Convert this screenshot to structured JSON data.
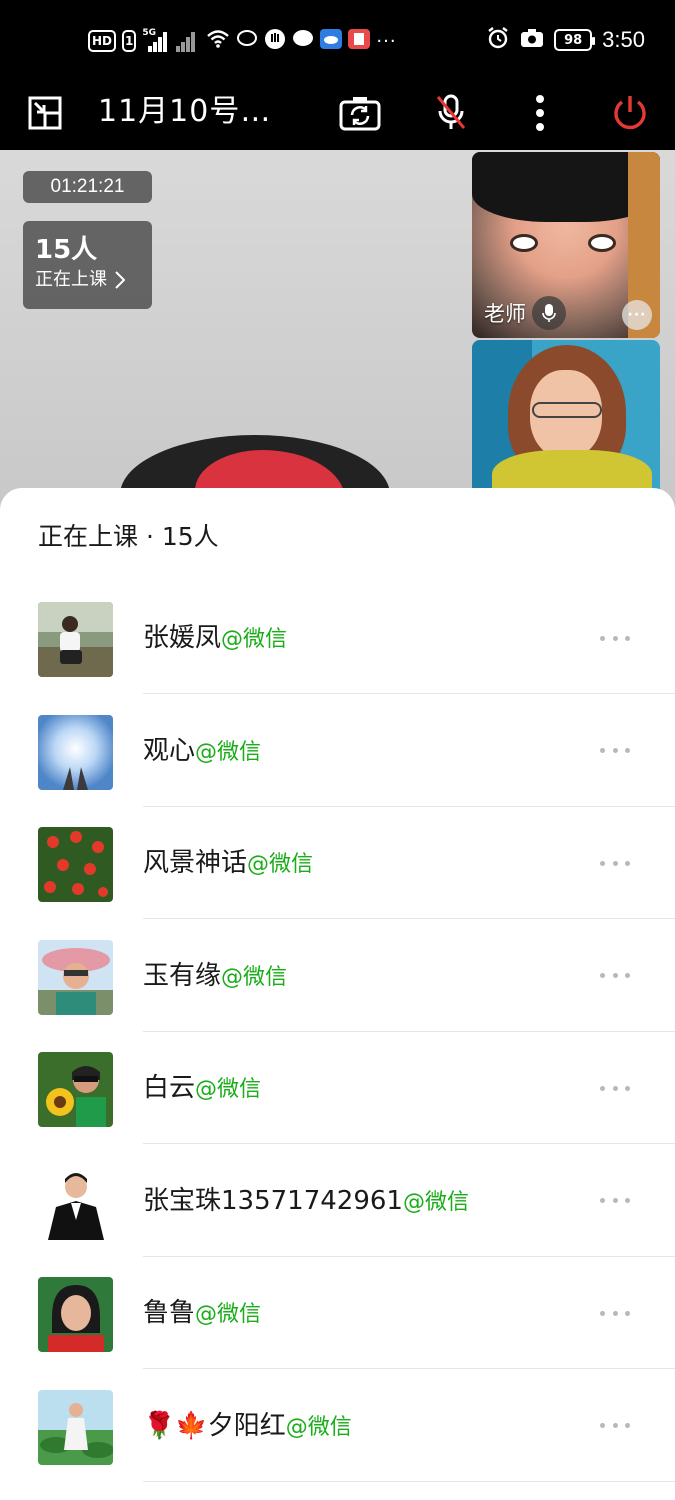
{
  "status_bar": {
    "left_indicators": [
      "HD",
      "1"
    ],
    "network": "5G",
    "battery": "98",
    "time": "3:50"
  },
  "toolbar": {
    "title": "11月10号…",
    "icons": [
      "exit-fullscreen-icon",
      "camera-switch-icon",
      "mic-muted-icon",
      "more-vertical-icon",
      "power-icon"
    ],
    "accent_color": "#e53935"
  },
  "video": {
    "timer": "01:21:21",
    "count": "15人",
    "count_sub": "正在上课",
    "teacher_label": "老师"
  },
  "sheet": {
    "title": "正在上课 · 15人",
    "participants": [
      {
        "name": "张媛凤",
        "tag": "@微信"
      },
      {
        "name": "观心",
        "tag": "@微信"
      },
      {
        "name": "风景神话",
        "tag": "@微信"
      },
      {
        "name": "玉有缘",
        "tag": "@微信"
      },
      {
        "name": "白云",
        "tag": "@微信"
      },
      {
        "name": "张宝珠13571742961",
        "tag": "@微信"
      },
      {
        "name": "鲁鲁",
        "tag": "@微信"
      },
      {
        "name": "🌹🍁夕阳红",
        "tag": "@微信"
      }
    ],
    "tag_color": "#1aad19"
  }
}
